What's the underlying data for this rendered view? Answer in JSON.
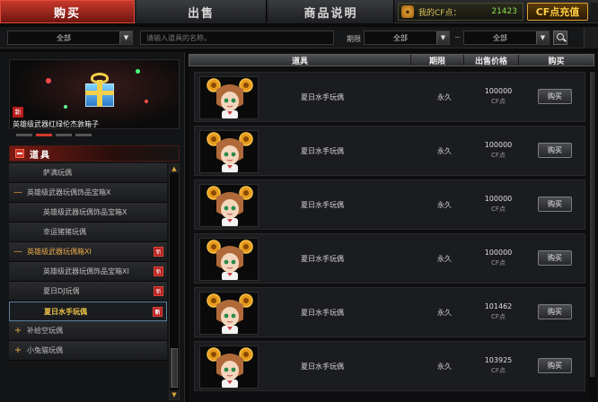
{
  "tabs": {
    "buy": "购买",
    "sell": "出售",
    "info": "商品说明"
  },
  "cf": {
    "icon": "coin-icon",
    "label": "我的CF点：",
    "value": "21423",
    "recharge": "CF点充值"
  },
  "filters": {
    "category": "全部",
    "search_placeholder": "请输入道具的名称。",
    "period_label": "期限",
    "period": "全部",
    "tilde": "~",
    "price": "全部"
  },
  "banner": {
    "new": "新",
    "caption": "英雄级武器红绿伦杰敦箱子"
  },
  "category_header": "道具",
  "categories": [
    {
      "label": "萨满玩偶",
      "mark": "",
      "new": ""
    },
    {
      "label": "英雄级武器玩偶饰品宝箱X",
      "mark": "—",
      "new": ""
    },
    {
      "label": "英雄级武器玩偶饰品宝箱X",
      "mark": "",
      "new": ""
    },
    {
      "label": "幸运猪猪玩偶",
      "mark": "",
      "new": ""
    },
    {
      "label": "英雄级武器玩偶箱XI",
      "mark": "—",
      "new": "新"
    },
    {
      "label": "英雄级武器玩偶饰品宝箱XI",
      "mark": "",
      "new": "新"
    },
    {
      "label": "夏日DJ玩偶",
      "mark": "",
      "new": "新"
    },
    {
      "label": "夏日水手玩偶",
      "mark": "",
      "new": "新"
    },
    {
      "label": "补给空玩偶",
      "mark": "+",
      "new": ""
    },
    {
      "label": "小兔猫玩偶",
      "mark": "+",
      "new": ""
    }
  ],
  "table": {
    "headers": {
      "item": "道具",
      "period": "期限",
      "price": "出售价格",
      "buy": "购买"
    },
    "rows": [
      {
        "name": "夏日水手玩偶",
        "period": "永久",
        "price": "100000",
        "unit": "CF点",
        "buy": "购买"
      },
      {
        "name": "夏日水手玩偶",
        "period": "永久",
        "price": "100000",
        "unit": "CF点",
        "buy": "购买"
      },
      {
        "name": "夏日水手玩偶",
        "period": "永久",
        "price": "100000",
        "unit": "CF点",
        "buy": "购买"
      },
      {
        "name": "夏日水手玩偶",
        "period": "永久",
        "price": "100000",
        "unit": "CF点",
        "buy": "购买"
      },
      {
        "name": "夏日水手玩偶",
        "period": "永久",
        "price": "101462",
        "unit": "CF点",
        "buy": "购买"
      },
      {
        "name": "夏日水手玩偶",
        "period": "永久",
        "price": "103925",
        "unit": "CF点",
        "buy": "购买"
      }
    ]
  },
  "colors": {
    "accent_red": "#c8382b",
    "cf_green": "#8fe04b",
    "gold": "#e8a84a",
    "selected_text": "#f4c84a"
  }
}
